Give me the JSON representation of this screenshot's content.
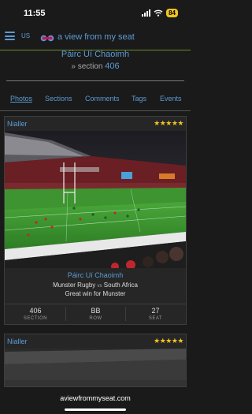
{
  "status": {
    "time": "11:55",
    "battery": "84"
  },
  "header": {
    "region": "US",
    "title": "a view from my seat",
    "logo_icon": "binoculars-icon"
  },
  "venue": {
    "name": "Páirc Uí Chaoimh",
    "section_prefix": "»",
    "section_label": "section",
    "section_number": "406"
  },
  "tabs": [
    {
      "label": "Photos",
      "active": true
    },
    {
      "label": "Sections",
      "active": false
    },
    {
      "label": "Comments",
      "active": false
    },
    {
      "label": "Tags",
      "active": false
    },
    {
      "label": "Events",
      "active": false
    }
  ],
  "photos": [
    {
      "user": "Nialler",
      "stars": "★★★★★",
      "venue": "Páirc Uí Chaoimh",
      "event_home": "Munster Rugby",
      "event_vs": "vs",
      "event_away": "South Africa",
      "comment": "Great win for Munster",
      "stats": [
        {
          "value": "406",
          "label": "SECTION"
        },
        {
          "value": "BB",
          "label": "ROW"
        },
        {
          "value": "27",
          "label": "SEAT"
        }
      ]
    },
    {
      "user": "Nialler",
      "stars": "★★★★★"
    }
  ],
  "browser": {
    "url": "aviewfrommyseat.com"
  },
  "colors": {
    "accent": "#5b9bd5",
    "star": "#f0c420",
    "pitch": "#3f9a2e",
    "header_rule": "#6a8a2a"
  }
}
